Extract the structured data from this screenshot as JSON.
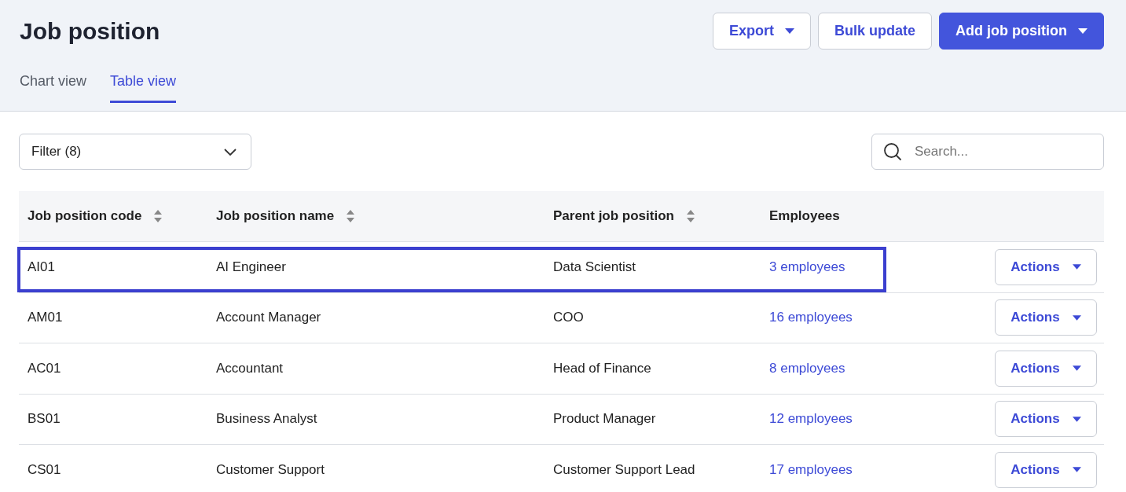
{
  "page": {
    "title": "Job position"
  },
  "header_buttons": [
    {
      "label": "Export",
      "kind": "dropdown",
      "primary": false
    },
    {
      "label": "Bulk update",
      "kind": "plain",
      "primary": false
    },
    {
      "label": "Add job position",
      "kind": "dropdown",
      "primary": true
    }
  ],
  "tabs": [
    {
      "label": "Chart view",
      "selected": false
    },
    {
      "label": "Table view",
      "selected": true
    }
  ],
  "filter": {
    "label": "Filter (8)"
  },
  "search": {
    "placeholder": "Search..."
  },
  "table": {
    "columns": [
      {
        "label": "Job position code",
        "sortable": true
      },
      {
        "label": "Job position name",
        "sortable": true
      },
      {
        "label": "Parent job position",
        "sortable": true
      },
      {
        "label": "Employees",
        "sortable": false
      }
    ],
    "rows": [
      {
        "code": "AI01",
        "name": "AI Engineer",
        "parent": "Data Scientist",
        "employees": "3 employees",
        "action": "Actions",
        "highlighted": true
      },
      {
        "code": "AM01",
        "name": "Account Manager",
        "parent": "COO",
        "employees": "16 employees",
        "action": "Actions",
        "highlighted": false
      },
      {
        "code": "AC01",
        "name": "Accountant",
        "parent": "Head of Finance",
        "employees": "8 employees",
        "action": "Actions",
        "highlighted": false
      },
      {
        "code": "BS01",
        "name": "Business Analyst",
        "parent": "Product Manager",
        "employees": "12 employees",
        "action": "Actions",
        "highlighted": false
      },
      {
        "code": "CS01",
        "name": "Customer Support",
        "parent": "Customer Support Lead",
        "employees": "17 employees",
        "action": "Actions",
        "highlighted": false
      }
    ]
  }
}
